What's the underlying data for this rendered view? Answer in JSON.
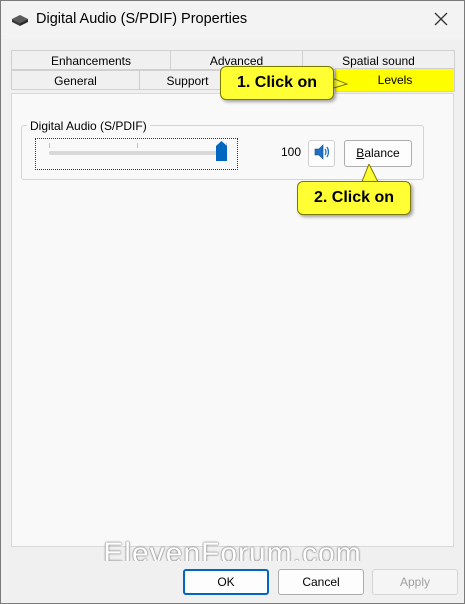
{
  "window": {
    "title": "Digital Audio (S/PDIF) Properties"
  },
  "tabs": {
    "row1": [
      {
        "label": "Enhancements"
      },
      {
        "label": "Advanced"
      },
      {
        "label": "Spatial sound"
      }
    ],
    "row2": [
      {
        "label": "General"
      },
      {
        "label": "Support"
      },
      {
        "label": "Levels",
        "selected": true
      }
    ]
  },
  "levels": {
    "device_label": "Digital Audio (S/PDIF)",
    "level_value": "100",
    "level_fraction": 1.0,
    "balance_label": "Balance",
    "mute_state": "unmuted"
  },
  "callouts": {
    "step1": "1. Click on",
    "step2": "2. Click on"
  },
  "watermark": "ElevenForum.com",
  "buttons": {
    "ok": "OK",
    "cancel": "Cancel",
    "apply": "Apply"
  },
  "colors": {
    "highlight": "#ffff00",
    "accent": "#0067c0",
    "slider_thumb": "#0067c0"
  },
  "icons": {
    "title": "speaker-device-icon",
    "close": "close-icon",
    "mute": "speaker-volume-icon"
  }
}
